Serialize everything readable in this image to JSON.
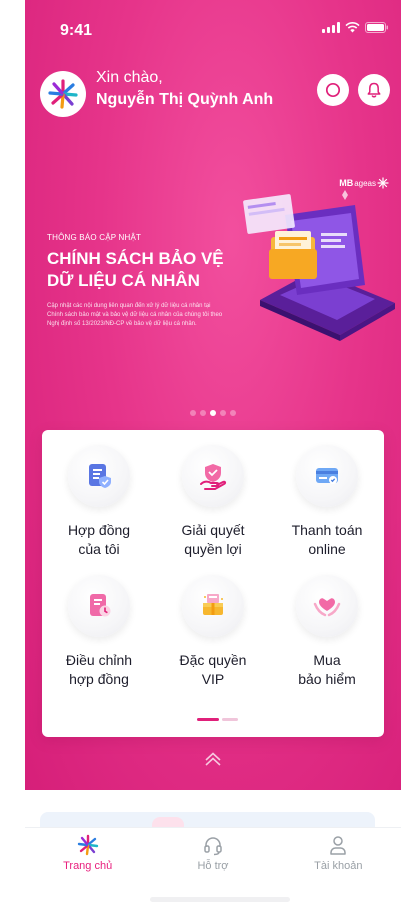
{
  "status": {
    "time": "9:41"
  },
  "header": {
    "greeting": "Xin chào,",
    "user_name": "Nguyễn Thị Quỳnh Anh"
  },
  "brand": {
    "name": "MB",
    "sub": "ageas"
  },
  "banner": {
    "tag": "THÔNG BÁO CẬP NHẬT",
    "title_line1": "CHÍNH SÁCH BẢO VỆ",
    "title_line2": "DỮ LIỆU CÁ NHÂN",
    "description": "Cập nhật các nội dung liên quan đến xử lý dữ liệu cá nhân tại Chính sách bảo mật và bảo vệ dữ liệu cá nhân của chúng tôi theo Nghị định số 13/2023/NĐ-CP về bảo vệ dữ liệu cá nhân.",
    "slide_count": 5,
    "active_slide": 3
  },
  "menu": [
    {
      "line1": "Hợp đồng",
      "line2": "của tôi",
      "icon": "contract-icon"
    },
    {
      "line1": "Giải quyết",
      "line2": "quyền lợi",
      "icon": "claim-icon"
    },
    {
      "line1": "Thanh toán",
      "line2": "online",
      "icon": "payment-card-icon"
    },
    {
      "line1": "Điều chỉnh",
      "line2": "hợp đồng",
      "icon": "contract-edit-icon"
    },
    {
      "line1": "Đặc quyền",
      "line2": "VIP",
      "icon": "vip-gift-icon"
    },
    {
      "line1": "Mua",
      "line2": "bảo hiểm",
      "icon": "buy-insurance-icon"
    }
  ],
  "menu_page": {
    "count": 2,
    "active": 1
  },
  "tabbar": {
    "items": [
      {
        "label": "Trang chủ",
        "icon": "home-star-icon",
        "active": true
      },
      {
        "label": "Hỗ trợ",
        "icon": "headset-icon",
        "active": false
      },
      {
        "label": "Tài khoản",
        "icon": "user-icon",
        "active": false
      }
    ]
  },
  "colors": {
    "primary": "#e6348a",
    "active_tab": "#e8207e",
    "icon_blue": "#4a6ee0",
    "icon_pink": "#e0207a"
  }
}
